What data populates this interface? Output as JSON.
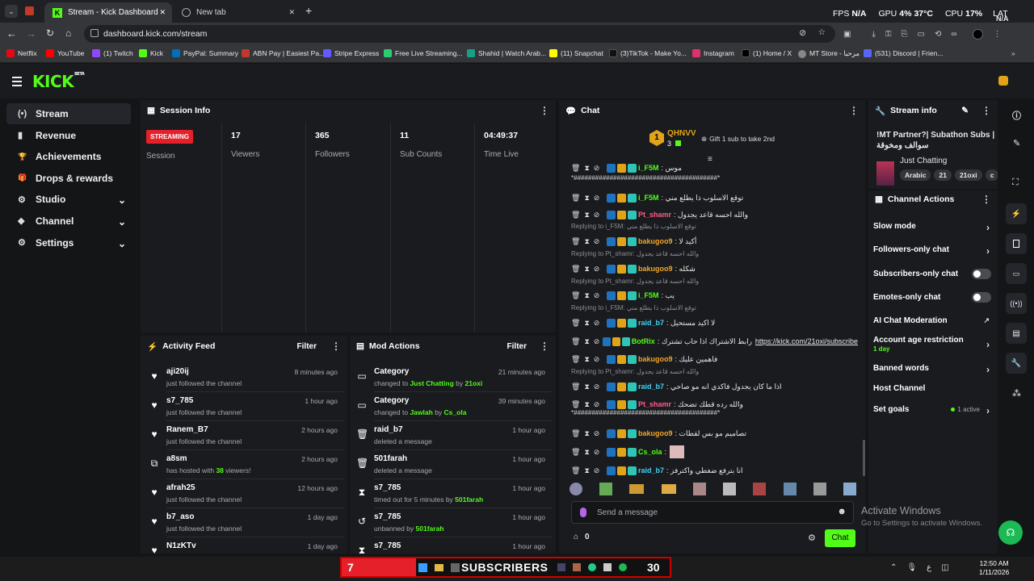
{
  "browser": {
    "tabs": [
      {
        "title": "Stream - Kick Dashboard",
        "close": "✕"
      },
      {
        "title": "New tab",
        "close": "✕"
      }
    ],
    "new_tab": "+",
    "url": "dashboard.kick.com/stream",
    "perf": {
      "fps_label": "FPS",
      "fps": "N/A",
      "gpu_label": "GPU",
      "gpu": "4%",
      "gpu_temp": "37°C",
      "cpu_label": "CPU",
      "cpu": "17%",
      "lat_label": "LAT",
      "lat": "N/A"
    },
    "bookmarks": [
      "Netflix",
      "YouTube",
      "(1) Twitch",
      "Kick",
      "PayPal: Summary",
      "ABN Pay | Easiest Pa...",
      "Stripe Express",
      "Free Live Streaming...",
      "Shahid | Watch Arab...",
      "(11) Snapchat",
      "(3)TikTok - Make Yo...",
      "Instagram",
      "(1) Home / X",
      "MT Store - مرحبا",
      "(531) Discord | Frien..."
    ]
  },
  "kick": {
    "logo": "KICK",
    "beta": "BETA"
  },
  "nav": [
    {
      "label": "Stream",
      "icon": "(•)"
    },
    {
      "label": "Revenue",
      "icon": "▮"
    },
    {
      "label": "Achievements",
      "icon": "🏆"
    },
    {
      "label": "Drops & rewards",
      "icon": "🎁"
    },
    {
      "label": "Studio",
      "icon": "⚙"
    },
    {
      "label": "Channel",
      "icon": "◆"
    },
    {
      "label": "Settings",
      "icon": "⚙"
    }
  ],
  "session": {
    "title": "Session Info",
    "status": "STREAMING",
    "status_sub": "Session",
    "stats": [
      {
        "value": "17",
        "label": "Viewers"
      },
      {
        "value": "365",
        "label": "Followers"
      },
      {
        "value": "11",
        "label": "Sub Counts"
      },
      {
        "value": "04:49:37",
        "label": "Time Live"
      }
    ]
  },
  "activity": {
    "title": "Activity Feed",
    "filter": "Filter",
    "items": [
      {
        "name": "aji20ij",
        "text": "just followed the channel",
        "time": "8 minutes ago",
        "icon": "heart"
      },
      {
        "name": "s7_785",
        "text": "just followed the channel",
        "time": "1 hour ago",
        "icon": "heart"
      },
      {
        "name": "Ranem_B7",
        "text": "just followed the channel",
        "time": "2 hours ago",
        "icon": "heart"
      },
      {
        "name": "a8sm",
        "text": "has hosted with",
        "extra": "38",
        "extra2": "viewers!",
        "time": "2 hours ago",
        "icon": "host"
      },
      {
        "name": "afrah25",
        "text": "just followed the channel",
        "time": "12 hours ago",
        "icon": "heart"
      },
      {
        "name": "b7_aso",
        "text": "just followed the channel",
        "time": "1 day ago",
        "icon": "heart"
      },
      {
        "name": "N1zKTv",
        "text": "",
        "time": "1 day ago",
        "icon": "heart"
      }
    ]
  },
  "mod": {
    "title": "Mod Actions",
    "filter": "Filter",
    "items": [
      {
        "name": "Category",
        "pre": "changed to",
        "hl": "Just Chatting",
        "mid": "by",
        "by": "21oxi",
        "time": "21 minutes ago",
        "icon": "cat"
      },
      {
        "name": "Category",
        "pre": "changed to",
        "hl": "Jawlah",
        "mid": "by",
        "by": "Cs_ola",
        "time": "39 minutes ago",
        "icon": "cat"
      },
      {
        "name": "raid_b7",
        "pre": "deleted a message",
        "time": "1 hour ago",
        "icon": "trash"
      },
      {
        "name": "501farah",
        "pre": "deleted a message",
        "time": "1 hour ago",
        "icon": "trash"
      },
      {
        "name": "s7_785",
        "pre": "timed out for 5 minutes by",
        "by": "501farah",
        "time": "1 hour ago",
        "icon": "timer"
      },
      {
        "name": "s7_785",
        "pre": "unbanned by",
        "by": "501farah",
        "time": "1 hour ago",
        "icon": "undo"
      },
      {
        "name": "s7_785",
        "pre": "",
        "time": "1 hour ago",
        "icon": "timer"
      }
    ]
  },
  "chat": {
    "title": "Chat",
    "top_gifter": {
      "rank": "1",
      "name": "QHNVV",
      "count": "3"
    },
    "gift_cta": "Gift 1 sub to take 2nd",
    "messages": [
      {
        "type": "msg",
        "user": "i_F5M",
        "color": "#53fc18",
        "text": ": موس"
      },
      {
        "type": "sep",
        "text": "*########################################*"
      },
      {
        "type": "msg",
        "user": "i_F5M",
        "color": "#53fc18",
        "text": ": توقع الاسلوب ذا يطلع مني"
      },
      {
        "type": "msg",
        "user": "Pt_shamr",
        "color": "#ff5c8a",
        "text": ": والله احسه قاعد يجدول"
      },
      {
        "type": "reply",
        "text": "Replying to i_F5M: توقع الاسلوب ذا يطلع مني"
      },
      {
        "type": "msg",
        "user": "bakugoo9",
        "color": "#f5a623",
        "text": ": أكيد لا"
      },
      {
        "type": "reply",
        "text": "Replying to Pt_shamr: والله احسه قاعد يجدول"
      },
      {
        "type": "msg",
        "user": "bakugoo9",
        "color": "#f5a623",
        "text": ": شكله"
      },
      {
        "type": "reply",
        "text": "Replying to Pt_shamr: والله احسه قاعد يجدول"
      },
      {
        "type": "msg",
        "user": "i_F5M",
        "color": "#53fc18",
        "text": ": يب"
      },
      {
        "type": "reply",
        "text": "Replying to i_F5M: توقع الاسلوب ذا يطلع مني"
      },
      {
        "type": "msg",
        "user": "raid_b7",
        "color": "#3fd4f5",
        "text": ": لا اكيد مستحيل"
      },
      {
        "type": "msg",
        "user": "BotRix",
        "color": "#53fc18",
        "text": ": رابط الاشتراك اذا حاب تشترك",
        "link": "https://kick.com/21oxi/subscribe"
      },
      {
        "type": "msg",
        "user": "bakugoo9",
        "color": "#f5a623",
        "text": ": فاهمين عليك"
      },
      {
        "type": "reply",
        "text": "Replying to Pt_shamr: والله احسه قاعد يجدول"
      },
      {
        "type": "msg",
        "user": "raid_b7",
        "color": "#3fd4f5",
        "text": ": اذا ما كان يجدول فاكدي انه مو صاحي"
      },
      {
        "type": "msg",
        "user": "Pt_shamr",
        "color": "#ff5c8a",
        "text": ": والله رده قطك تضحك"
      },
      {
        "type": "sep",
        "text": "*########################################*"
      },
      {
        "type": "msg",
        "user": "bakugoo9",
        "color": "#f5a623",
        "text": ": تصاميم مو بس لقطات"
      },
      {
        "type": "msg",
        "user": "Cs_ola",
        "color": "#53fc18",
        "text": ":"
      },
      {
        "type": "msg",
        "user": "raid_b7",
        "color": "#3fd4f5",
        "text": ": انا بترفع ضغطي واكترفز"
      }
    ],
    "input_placeholder": "Send a message",
    "points": "0",
    "send": "Chat"
  },
  "stream_info": {
    "title": "Stream info",
    "stream_title": "!MT Partner?| Subathon Subs | سوالف ومخوقة",
    "category": "Just Chatting",
    "tags": [
      "Arabic",
      "21",
      "21oxi",
      "c"
    ]
  },
  "channel_actions": {
    "title": "Channel Actions",
    "items": [
      {
        "label": "Slow mode",
        "ctl": "chevron"
      },
      {
        "label": "Followers-only chat",
        "ctl": "chevron"
      },
      {
        "label": "Subscribers-only chat",
        "ctl": "toggle"
      },
      {
        "label": "Emotes-only chat",
        "ctl": "toggle"
      },
      {
        "label": "AI Chat Moderation",
        "ctl": "ext"
      },
      {
        "label": "Account age restriction",
        "sub": "1 day",
        "ctl": "chevron"
      },
      {
        "label": "Banned words",
        "ctl": "chevron"
      },
      {
        "label": "Host Channel",
        "ctl": "none"
      },
      {
        "label": "Set goals",
        "status": "1 active",
        "ctl": "chevron"
      }
    ]
  },
  "windows": {
    "activate_title": "Activate Windows",
    "activate_sub": "Go to Settings to activate Windows.",
    "clock": "12:50 AM",
    "date": "1/11/2026",
    "lang": "ع"
  },
  "overlay": {
    "left": "7",
    "label": "SUBSCRIBERS",
    "right": "30"
  },
  "colors": {
    "kick_green": "#53fc18",
    "streaming_red": "#e5202a",
    "panel": "#191b1f"
  }
}
